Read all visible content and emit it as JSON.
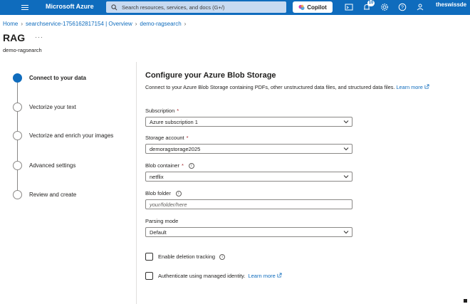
{
  "topbar": {
    "brand": "Microsoft Azure",
    "search_placeholder": "Search resources, services, and docs (G+/)",
    "copilot_label": "Copilot",
    "notification_count": "10",
    "user": "theswissde",
    "color": "#0f6cbd"
  },
  "breadcrumb": {
    "items": [
      "Home",
      "searchservice-1756162817154 | Overview",
      "demo-ragsearch"
    ]
  },
  "page": {
    "title": "RAG",
    "more": "···",
    "subtitle": "demo-ragsearch"
  },
  "wizard": {
    "steps": [
      {
        "label": "Connect to your data",
        "active": true
      },
      {
        "label": "Vectorize your text",
        "active": false
      },
      {
        "label": "Vectorize and enrich your images",
        "active": false
      },
      {
        "label": "Advanced settings",
        "active": false
      },
      {
        "label": "Review and create",
        "active": false
      }
    ]
  },
  "form": {
    "title": "Configure your Azure Blob Storage",
    "description": "Connect to your Azure Blob Storage containing PDFs, other unstructured data files, and structured data files.",
    "learn_more": "Learn more",
    "subscription": {
      "label": "Subscription",
      "value": "Azure subscription 1"
    },
    "storage_account": {
      "label": "Storage account",
      "value": "demoragstorage2025"
    },
    "blob_container": {
      "label": "Blob container",
      "value": "netflix"
    },
    "blob_folder": {
      "label": "Blob folder",
      "placeholder": "your/folder/here"
    },
    "parsing_mode": {
      "label": "Parsing mode",
      "value": "Default"
    },
    "deletion_tracking": {
      "label": "Enable deletion tracking",
      "checked": false
    },
    "managed_identity": {
      "label": "Authenticate using managed identity.",
      "link": "Learn more",
      "checked": false
    }
  }
}
